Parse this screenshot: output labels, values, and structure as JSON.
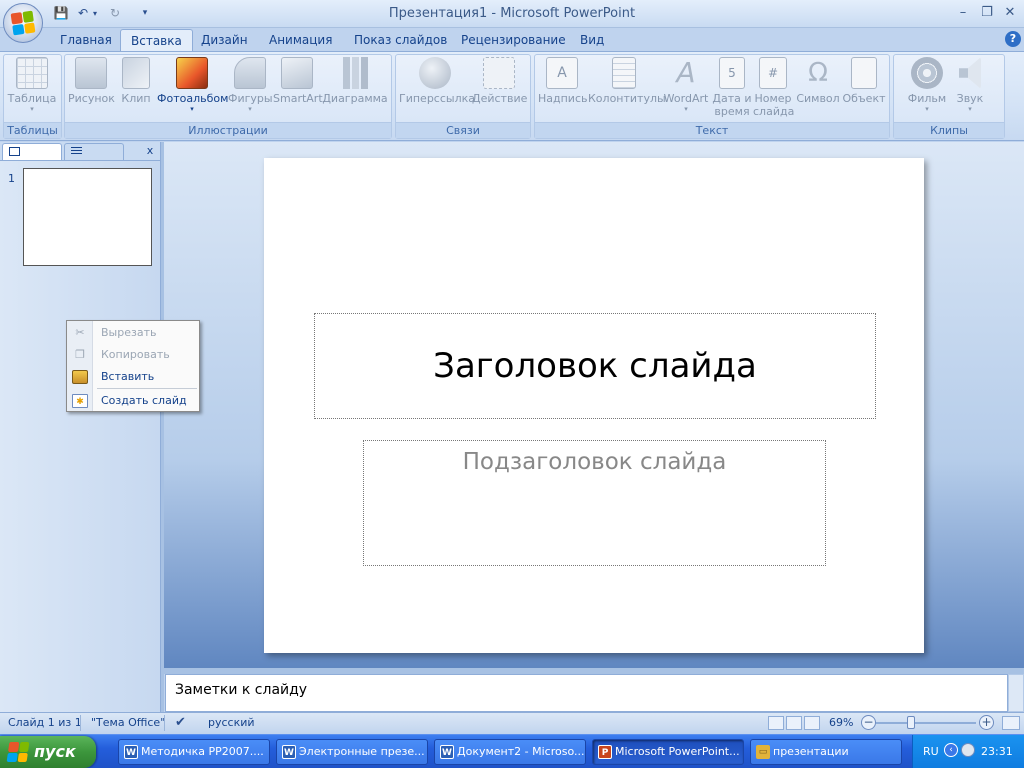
{
  "app": {
    "title": "Презентация1 - Microsoft PowerPoint"
  },
  "window_controls": {
    "minimize": "–",
    "restore": "❐",
    "close": "✕"
  },
  "quick_access": {
    "save": "💾",
    "undo": "↶",
    "redo": "↻",
    "customize": "▾"
  },
  "ribbon_tabs": [
    "Главная",
    "Вставка",
    "Дизайн",
    "Анимация",
    "Показ слайдов",
    "Рецензирование",
    "Вид"
  ],
  "active_tab": "Вставка",
  "help": "?",
  "groups": [
    {
      "label": "Таблицы"
    },
    {
      "label": "Иллюстрации"
    },
    {
      "label": "Связи"
    },
    {
      "label": "Текст"
    },
    {
      "label": "Клипы мультимедиа"
    }
  ],
  "buttons": {
    "table": {
      "label": "Таблица",
      "icon": "table-icon",
      "arrow": "▾"
    },
    "picture": {
      "label": "Рисунок",
      "icon": "picture-icon"
    },
    "clip": {
      "label": "Клип",
      "icon": "clipart-icon"
    },
    "photoalbum": {
      "label": "Фотоальбом",
      "icon": "photo-album-icon",
      "arrow": "▾"
    },
    "shapes": {
      "label": "Фигуры",
      "icon": "shapes-icon",
      "arrow": "▾"
    },
    "smartart": {
      "label": "SmartArt",
      "icon": "smartart-icon"
    },
    "chart": {
      "label": "Диаграмма",
      "icon": "chart-icon"
    },
    "hyperlink": {
      "label": "Гиперссылка",
      "icon": "hyperlink-icon"
    },
    "action": {
      "label": "Действие",
      "icon": "action-icon"
    },
    "textbox": {
      "label": "Надпись",
      "icon": "textbox-icon"
    },
    "headerfooter": {
      "label": "Колонтитулы",
      "icon": "header-footer-icon"
    },
    "wordart": {
      "label": "WordArt",
      "icon": "wordart-icon",
      "arrow": "▾"
    },
    "datetime": {
      "label1": "Дата и",
      "label2": "время",
      "icon": "date-time-icon"
    },
    "slidenumber": {
      "label1": "Номер",
      "label2": "слайда",
      "icon": "slide-number-icon"
    },
    "symbol": {
      "label": "Символ",
      "icon": "symbol-icon"
    },
    "object": {
      "label": "Объект",
      "icon": "object-icon"
    },
    "movie": {
      "label": "Фильм",
      "icon": "movie-icon",
      "arrow": "▾"
    },
    "sound": {
      "label": "Звук",
      "icon": "sound-icon",
      "arrow": "▾"
    }
  },
  "left_pane": {
    "close": "x",
    "slide_number": "1"
  },
  "context_menu": {
    "items": [
      {
        "label": "Вырезать",
        "icon": "scissors-icon",
        "enabled": false
      },
      {
        "label": "Копировать",
        "icon": "copy-icon",
        "enabled": false
      },
      {
        "label": "Вставить",
        "icon": "paste-icon",
        "enabled": true
      },
      {
        "label": "Создать слайд",
        "icon": "new-slide-icon",
        "enabled": true
      }
    ]
  },
  "slide": {
    "title": "Заголовок слайда",
    "subtitle": "Подзаголовок слайда"
  },
  "notes": {
    "text": "Заметки к слайду"
  },
  "status": {
    "slide_info": "Слайд 1 из 1",
    "theme": "\"Тема Office\"",
    "language": "русский",
    "zoom": "69%",
    "zoom_minus": "−",
    "zoom_plus": "+"
  },
  "taskbar": {
    "start": "пуск",
    "tasks": [
      {
        "label": "Методичка PP2007....",
        "icon": "W",
        "color": "#2b5fb4"
      },
      {
        "label": "Электронные презе...",
        "icon": "W",
        "color": "#2b5fb4"
      },
      {
        "label": "Документ2 - Microso...",
        "icon": "W",
        "color": "#2b5fb4"
      },
      {
        "label": "Microsoft PowerPoint...",
        "icon": "P",
        "color": "#c8451d",
        "active": true
      },
      {
        "label": "презентации",
        "icon": "▭",
        "color": "#e2b33a"
      }
    ],
    "lang": "RU",
    "clock": "23:31"
  },
  "colors": {
    "accent": "#15428b",
    "ribbon": "#d4e3f6",
    "taskbar": "#245edb"
  }
}
